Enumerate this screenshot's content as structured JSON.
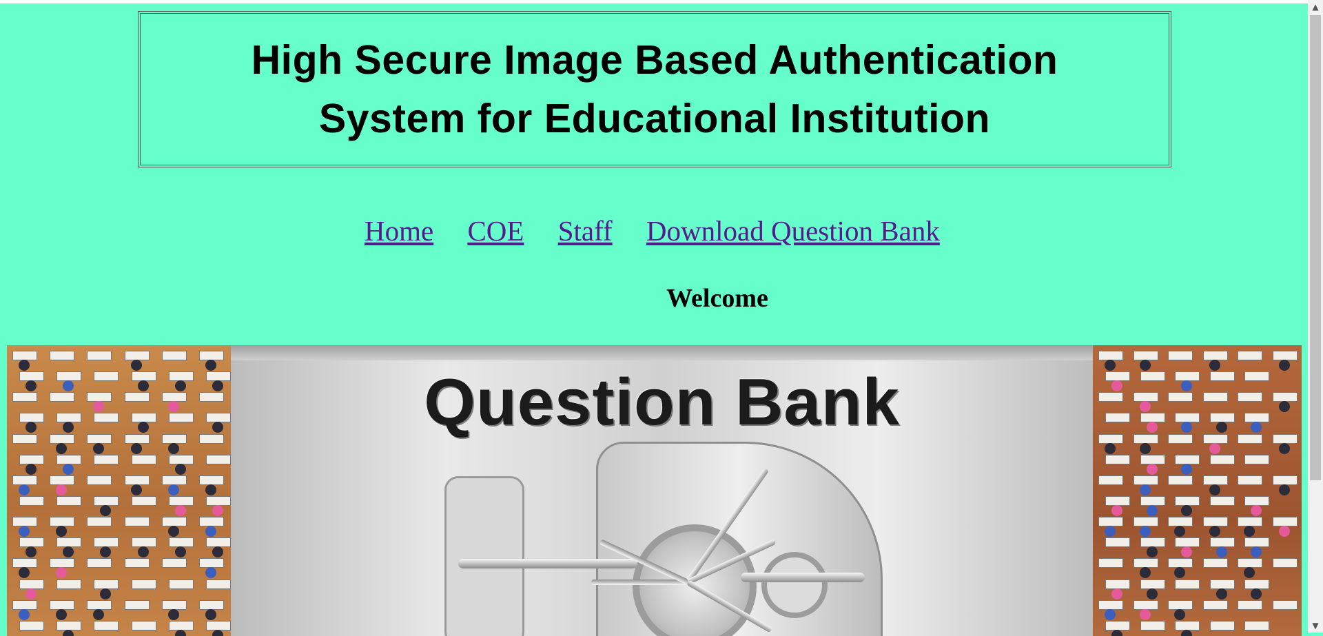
{
  "header": {
    "title_line1": "High Secure Image Based Authentication",
    "title_line2": "System for Educational Institution"
  },
  "nav": {
    "items": [
      {
        "label": "Home"
      },
      {
        "label": "COE"
      },
      {
        "label": "Staff"
      },
      {
        "label": "Download Question Bank"
      }
    ]
  },
  "main": {
    "welcome": "Welcome",
    "banner_text": "Question Bank"
  },
  "scrollbar": {
    "up_icon": "▲",
    "down_icon": "▼"
  },
  "colors": {
    "background": "#66ffcc",
    "link": "#551a8b"
  }
}
